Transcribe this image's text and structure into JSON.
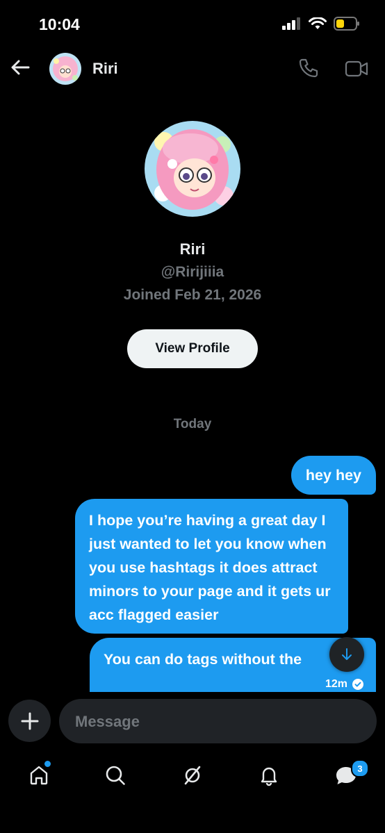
{
  "status": {
    "time": "10:04"
  },
  "header": {
    "name": "Riri"
  },
  "profile": {
    "name": "Riri",
    "handle": "@Ririjiiia",
    "joined": "Joined Feb 21, 2026",
    "view_profile_label": "View Profile"
  },
  "conversation": {
    "date_separator": "Today",
    "messages": [
      {
        "text": "hey hey"
      },
      {
        "text": "I hope you’re having a great day I just wanted to let you know when you use hashtags it does attract minors to your page and it gets ur acc flagged easier"
      },
      {
        "text": "You can do tags without the",
        "time": "12m"
      }
    ]
  },
  "composer": {
    "placeholder": "Message"
  },
  "tabbar": {
    "notifications_badge": "3"
  },
  "colors": {
    "accent": "#1d9bf0",
    "background": "#000000",
    "muted": "#71767b",
    "surface": "#202327"
  },
  "icons": [
    "back-arrow-icon",
    "phone-icon",
    "video-camera-icon",
    "plus-icon",
    "arrow-down-icon",
    "home-icon",
    "search-icon",
    "grok-icon",
    "bell-icon",
    "messages-icon",
    "read-check-icon"
  ]
}
